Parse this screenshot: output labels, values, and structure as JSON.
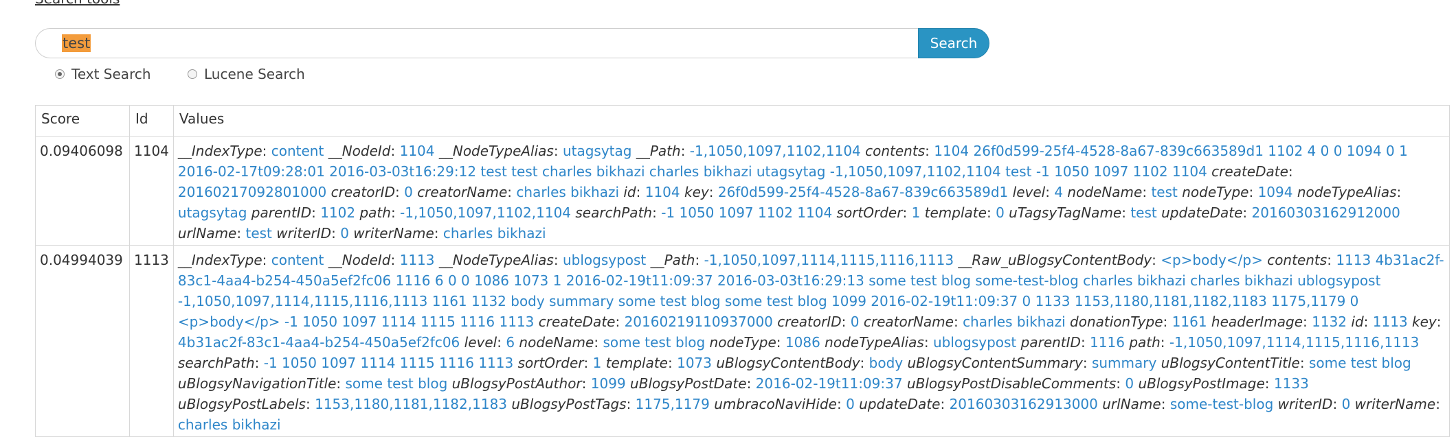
{
  "top_link": "Search tools",
  "search": {
    "value": "test",
    "button_label": "Search"
  },
  "search_types": [
    {
      "label": "Text Search",
      "checked": true
    },
    {
      "label": "Lucene Search",
      "checked": false
    }
  ],
  "table": {
    "headers": {
      "score": "Score",
      "id": "Id",
      "values": "Values"
    },
    "rows": [
      {
        "score": "0.09406098",
        "id": "1104",
        "fields": [
          {
            "name": "__IndexType",
            "value": "content"
          },
          {
            "name": "__NodeId",
            "value": "1104"
          },
          {
            "name": "__NodeTypeAlias",
            "value": "utagsytag"
          },
          {
            "name": "__Path",
            "value": "-1,1050,1097,1102,1104"
          },
          {
            "name": "contents",
            "value": "1104 26f0d599-25f4-4528-8a67-839c663589d1 1102 4 0 0 1094 0 1 2016-02-17t09:28:01 2016-03-03t16:29:12 test test charles bikhazi charles bikhazi utagsytag -1,1050,1097,1102,1104 test -1 1050 1097 1102 1104"
          },
          {
            "name": "createDate",
            "value": "20160217092801000"
          },
          {
            "name": "creatorID",
            "value": "0"
          },
          {
            "name": "creatorName",
            "value": "charles bikhazi"
          },
          {
            "name": "id",
            "value": "1104"
          },
          {
            "name": "key",
            "value": "26f0d599-25f4-4528-8a67-839c663589d1"
          },
          {
            "name": "level",
            "value": "4"
          },
          {
            "name": "nodeName",
            "value": "test"
          },
          {
            "name": "nodeType",
            "value": "1094"
          },
          {
            "name": "nodeTypeAlias",
            "value": "utagsytag"
          },
          {
            "name": "parentID",
            "value": "1102"
          },
          {
            "name": "path",
            "value": "-1,1050,1097,1102,1104"
          },
          {
            "name": "searchPath",
            "value": "-1 1050 1097 1102 1104"
          },
          {
            "name": "sortOrder",
            "value": "1"
          },
          {
            "name": "template",
            "value": "0"
          },
          {
            "name": "uTagsyTagName",
            "value": "test"
          },
          {
            "name": "updateDate",
            "value": "20160303162912000"
          },
          {
            "name": "urlName",
            "value": "test"
          },
          {
            "name": "writerID",
            "value": "0"
          },
          {
            "name": "writerName",
            "value": "charles bikhazi"
          }
        ]
      },
      {
        "score": "0.04994039",
        "id": "1113",
        "fields": [
          {
            "name": "__IndexType",
            "value": "content"
          },
          {
            "name": "__NodeId",
            "value": "1113"
          },
          {
            "name": "__NodeTypeAlias",
            "value": "ublogsypost"
          },
          {
            "name": "__Path",
            "value": "-1,1050,1097,1114,1115,1116,1113"
          },
          {
            "name": "__Raw_uBlogsyContentBody",
            "value": "<p>body</p>"
          },
          {
            "name": "contents",
            "value": "1113 4b31ac2f-83c1-4aa4-b254-450a5ef2fc06 1116 6 0 0 1086 1073 1 2016-02-19t11:09:37 2016-03-03t16:29:13 some test blog some-test-blog charles bikhazi charles bikhazi ublogsypost -1,1050,1097,1114,1115,1116,1113 1161 1132 body summary some test blog some test blog 1099 2016-02-19t11:09:37 0 1133 1153,1180,1181,1182,1183 1175,1179 0 <p>body</p> -1 1050 1097 1114 1115 1116 1113"
          },
          {
            "name": "createDate",
            "value": "20160219110937000"
          },
          {
            "name": "creatorID",
            "value": "0"
          },
          {
            "name": "creatorName",
            "value": "charles bikhazi"
          },
          {
            "name": "donationType",
            "value": "1161"
          },
          {
            "name": "headerImage",
            "value": "1132"
          },
          {
            "name": "id",
            "value": "1113"
          },
          {
            "name": "key",
            "value": "4b31ac2f-83c1-4aa4-b254-450a5ef2fc06"
          },
          {
            "name": "level",
            "value": "6"
          },
          {
            "name": "nodeName",
            "value": "some test blog"
          },
          {
            "name": "nodeType",
            "value": "1086"
          },
          {
            "name": "nodeTypeAlias",
            "value": "ublogsypost"
          },
          {
            "name": "parentID",
            "value": "1116"
          },
          {
            "name": "path",
            "value": "-1,1050,1097,1114,1115,1116,1113"
          },
          {
            "name": "searchPath",
            "value": "-1 1050 1097 1114 1115 1116 1113"
          },
          {
            "name": "sortOrder",
            "value": "1"
          },
          {
            "name": "template",
            "value": "1073"
          },
          {
            "name": "uBlogsyContentBody",
            "value": "body"
          },
          {
            "name": "uBlogsyContentSummary",
            "value": "summary"
          },
          {
            "name": "uBlogsyContentTitle",
            "value": "some test blog"
          },
          {
            "name": "uBlogsyNavigationTitle",
            "value": "some test blog"
          },
          {
            "name": "uBlogsyPostAuthor",
            "value": "1099"
          },
          {
            "name": "uBlogsyPostDate",
            "value": "2016-02-19t11:09:37"
          },
          {
            "name": "uBlogsyPostDisableComments",
            "value": "0"
          },
          {
            "name": "uBlogsyPostImage",
            "value": "1133"
          },
          {
            "name": "uBlogsyPostLabels",
            "value": "1153,1180,1181,1182,1183"
          },
          {
            "name": "uBlogsyPostTags",
            "value": "1175,1179"
          },
          {
            "name": "umbracoNaviHide",
            "value": "0"
          },
          {
            "name": "updateDate",
            "value": "20160303162913000"
          },
          {
            "name": "urlName",
            "value": "some-test-blog"
          },
          {
            "name": "writerID",
            "value": "0"
          },
          {
            "name": "writerName",
            "value": "charles bikhazi"
          }
        ]
      }
    ]
  }
}
